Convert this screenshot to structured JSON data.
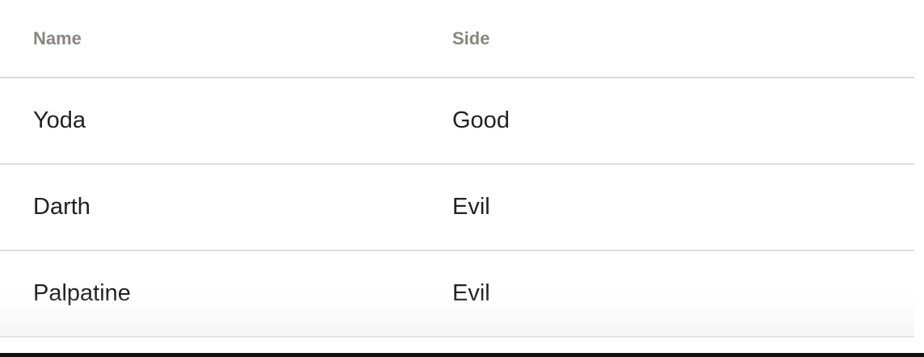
{
  "table": {
    "columns": [
      "Name",
      "Side"
    ],
    "rows": [
      {
        "name": "Yoda",
        "side": "Good"
      },
      {
        "name": "Darth",
        "side": "Evil"
      },
      {
        "name": "Palpatine",
        "side": "Evil"
      }
    ]
  },
  "colors": {
    "header_text": "#8a8580",
    "body_text": "#212121",
    "divider": "#dcdcdc",
    "background": "#ffffff"
  }
}
